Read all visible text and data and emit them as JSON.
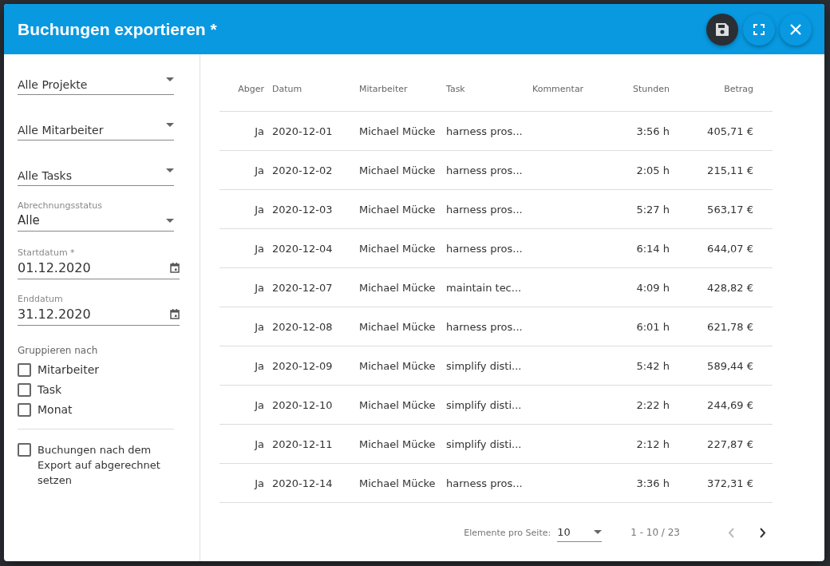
{
  "dialog": {
    "title": "Buchungen exportieren *",
    "actions": [
      {
        "kind": "save",
        "active": true
      },
      {
        "kind": "fullscreen",
        "active": false
      },
      {
        "kind": "close",
        "active": false
      }
    ]
  },
  "filters": {
    "selects": [
      {
        "value": "Alle Projekte"
      },
      {
        "value": "Alle Mitarbeiter"
      },
      {
        "value": "Alle Tasks"
      },
      {
        "label": "Abrechnungsstatus",
        "value": "Alle"
      }
    ],
    "dates": [
      {
        "label": "Startdatum *",
        "value": "01.12.2020"
      },
      {
        "label": "Enddatum",
        "value": "31.12.2020"
      }
    ],
    "group_label": "Gruppieren nach",
    "group_options": [
      {
        "label": "Mitarbeiter",
        "checked": false
      },
      {
        "label": "Task",
        "checked": false
      },
      {
        "label": "Monat",
        "checked": false
      }
    ],
    "mark_billed": {
      "label": "Buchungen nach dem Export auf abgerechnet setzen",
      "checked": false
    }
  },
  "table": {
    "columns": [
      "Abger",
      "Datum",
      "Mitarbeiter",
      "Task",
      "Kommentar",
      "Stunden",
      "Betrag"
    ],
    "rows": [
      [
        "Ja",
        "2020-12-01",
        "Michael Mücke",
        "harness pros...",
        "",
        "3:56 h",
        "405,71 €"
      ],
      [
        "Ja",
        "2020-12-02",
        "Michael Mücke",
        "harness pros...",
        "",
        "2:05 h",
        "215,11 €"
      ],
      [
        "Ja",
        "2020-12-03",
        "Michael Mücke",
        "harness pros...",
        "",
        "5:27 h",
        "563,17 €"
      ],
      [
        "Ja",
        "2020-12-04",
        "Michael Mücke",
        "harness pros...",
        "",
        "6:14 h",
        "644,07 €"
      ],
      [
        "Ja",
        "2020-12-07",
        "Michael Mücke",
        "maintain tec...",
        "",
        "4:09 h",
        "428,82 €"
      ],
      [
        "Ja",
        "2020-12-08",
        "Michael Mücke",
        "harness pros...",
        "",
        "6:01 h",
        "621,78 €"
      ],
      [
        "Ja",
        "2020-12-09",
        "Michael Mücke",
        "simplify disti...",
        "",
        "5:42 h",
        "589,44 €"
      ],
      [
        "Ja",
        "2020-12-10",
        "Michael Mücke",
        "simplify disti...",
        "",
        "2:22 h",
        "244,69 €"
      ],
      [
        "Ja",
        "2020-12-11",
        "Michael Mücke",
        "simplify disti...",
        "",
        "2:12 h",
        "227,87 €"
      ],
      [
        "Ja",
        "2020-12-14",
        "Michael Mücke",
        "harness pros...",
        "",
        "3:36 h",
        "372,31 €"
      ]
    ]
  },
  "paginator": {
    "label": "Elemente pro Seite:",
    "page_size": "10",
    "range": "1 - 10 / 23",
    "prev_disabled": true,
    "next_disabled": false
  }
}
